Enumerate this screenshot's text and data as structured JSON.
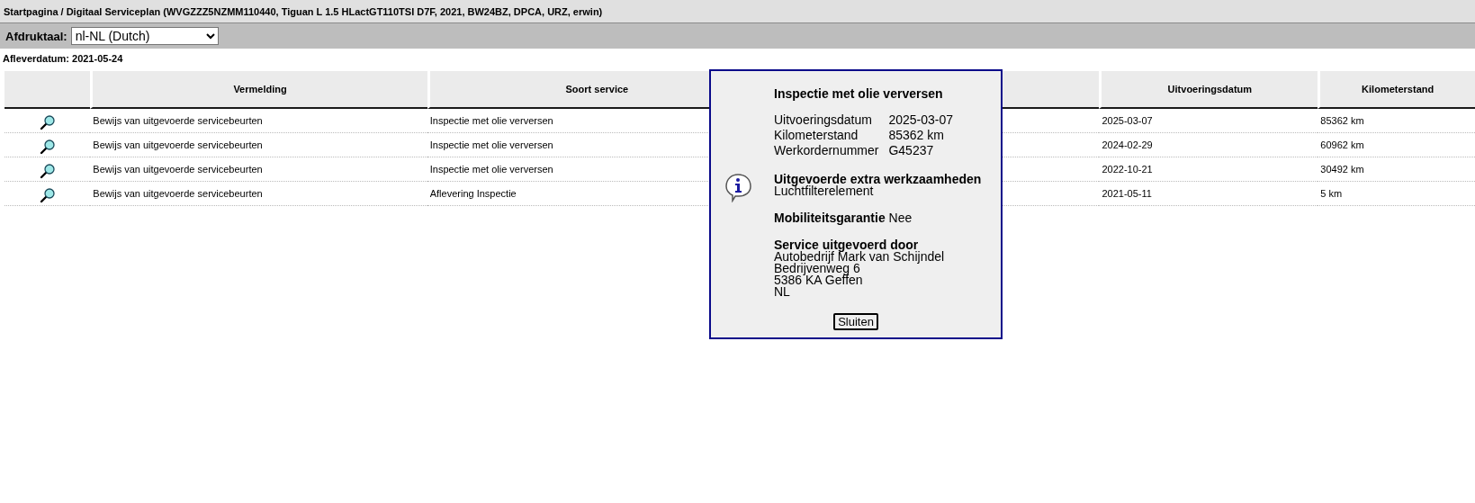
{
  "breadcrumb": "Startpagina / Digitaal Serviceplan (WVGZZZ5NZMM110440, Tiguan L 1.5 HLactGT110TSI D7F, 2021, BW24BZ, DPCA, URZ, erwin)",
  "print_language": {
    "label": "Afdruktaal:",
    "value": "nl-NL (Dutch)"
  },
  "delivery_date": "Afleverdatum: 2021-05-24",
  "table": {
    "columns": [
      "",
      "Vermelding",
      "Soort service",
      "",
      "Uitvoeringsdatum",
      "Kilometerstand"
    ],
    "rows": [
      {
        "entry": "Bewijs van uitgevoerde servicebeurten",
        "service": "Inspectie met olie verversen",
        "date": "2025-03-07",
        "mileage": "85362 km"
      },
      {
        "entry": "Bewijs van uitgevoerde servicebeurten",
        "service": "Inspectie met olie verversen",
        "date": "2024-02-29",
        "mileage": "60962 km"
      },
      {
        "entry": "Bewijs van uitgevoerde servicebeurten",
        "service": "Inspectie met olie verversen",
        "date": "2022-10-21",
        "mileage": "30492 km"
      },
      {
        "entry": "Bewijs van uitgevoerde servicebeurten",
        "service": "Aflevering Inspectie",
        "date": "2021-05-11",
        "mileage": "5 km"
      }
    ]
  },
  "popup": {
    "title": "Inspectie met olie verversen",
    "details": [
      {
        "label": "Uitvoeringsdatum",
        "value": "2025-03-07"
      },
      {
        "label": "Kilometerstand",
        "value": "85362 km"
      },
      {
        "label": "Werkordernummer",
        "value": "G45237"
      }
    ],
    "extra_work": {
      "heading": "Uitgevoerde extra werkzaamheden",
      "lines": [
        "Luchtfilterelement"
      ]
    },
    "mobility": {
      "label": "Mobiliteitsgarantie",
      "value": "Nee"
    },
    "performed_by": {
      "heading": "Service uitgevoerd door",
      "lines": [
        "Autobedrijf Mark van Schijndel",
        "Bedrijvenweg 6",
        "5386 KA Geffen",
        "NL"
      ]
    },
    "close_button": "Sluiten"
  }
}
